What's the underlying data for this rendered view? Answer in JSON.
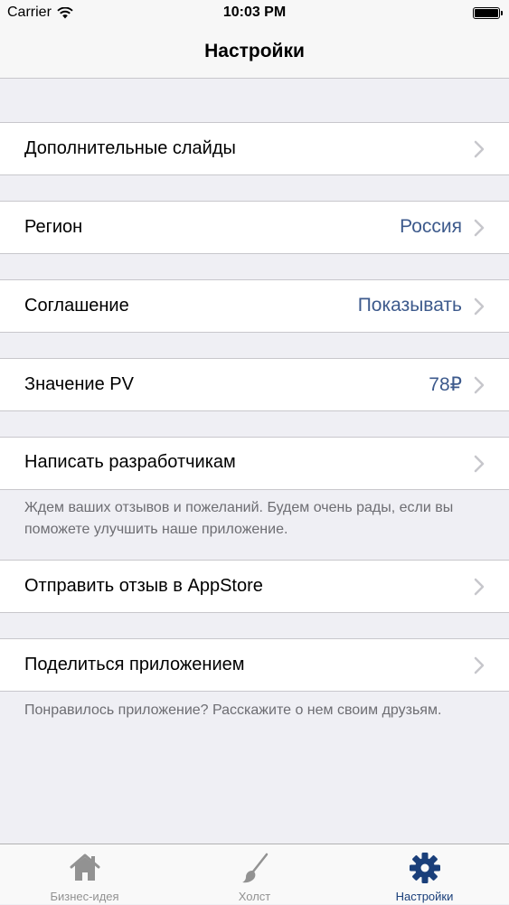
{
  "status_bar": {
    "carrier": "Carrier",
    "time": "10:03 PM"
  },
  "nav": {
    "title": "Настройки"
  },
  "settings": {
    "extra_slides": {
      "label": "Дополнительные слайды"
    },
    "region": {
      "label": "Регион",
      "value": "Россия"
    },
    "agreement": {
      "label": "Соглашение",
      "value": "Показывать"
    },
    "pv_value": {
      "label": "Значение PV",
      "value": "78₽"
    },
    "write_devs": {
      "label": "Написать разработчикам",
      "footer": "Ждем ваших отзывов и пожеланий. Будем очень рады, если вы поможете улучшить наше приложение."
    },
    "appstore_review": {
      "label": "Отправить отзыв в AppStore"
    },
    "share_app": {
      "label": "Поделиться приложением",
      "footer": "Понравилось приложение? Расскажите о нем своим друзьям."
    }
  },
  "tabs": [
    {
      "label": "Бизнес-идея",
      "icon": "home-icon",
      "active": false
    },
    {
      "label": "Холст",
      "icon": "brush-icon",
      "active": false
    },
    {
      "label": "Настройки",
      "icon": "gear-icon",
      "active": true
    }
  ],
  "colors": {
    "accent": "#1a3f7a",
    "value_text": "#3d5a8c",
    "inactive_tab": "#929292",
    "background": "#efeff4"
  }
}
